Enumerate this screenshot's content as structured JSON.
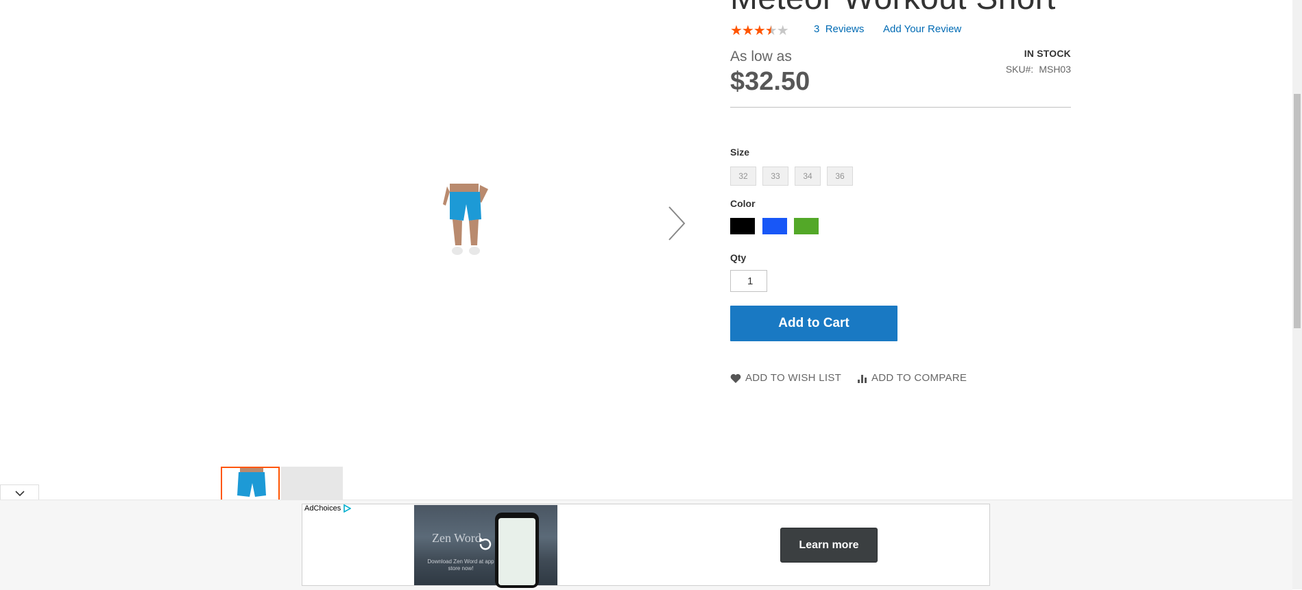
{
  "product": {
    "title": "Meteor Workout Short",
    "rating_percent": 70,
    "reviews_count": "3",
    "reviews_label": "Reviews",
    "add_review": "Add Your Review",
    "as_low_as": "As low as",
    "price": "$32.50",
    "stock": "IN STOCK",
    "sku_label": "SKU#:",
    "sku_value": "MSH03"
  },
  "options": {
    "size_label": "Size",
    "sizes": [
      "32",
      "33",
      "34",
      "36"
    ],
    "color_label": "Color",
    "colors": [
      {
        "name": "Black",
        "hex": "#000000"
      },
      {
        "name": "Blue",
        "hex": "#1857f7"
      },
      {
        "name": "Green",
        "hex": "#53a828"
      }
    ],
    "qty_label": "Qty",
    "qty_value": "1"
  },
  "actions": {
    "add_to_cart": "Add to Cart",
    "wish_list": "ADD TO WISH LIST",
    "compare": "ADD TO COMPARE"
  },
  "ad": {
    "adchoices": "AdChoices",
    "brand": "Zen Word",
    "tagline": "Download Zen Word at app store now!",
    "cta": "Learn more"
  },
  "colors": {
    "accent": "#1979c3",
    "link": "#006bb4",
    "star": "#ff5501"
  },
  "icons": [
    "heart-icon",
    "compare-icon",
    "chevron-right-icon",
    "chevron-down-icon",
    "adchoices-icon",
    "replay-icon"
  ]
}
